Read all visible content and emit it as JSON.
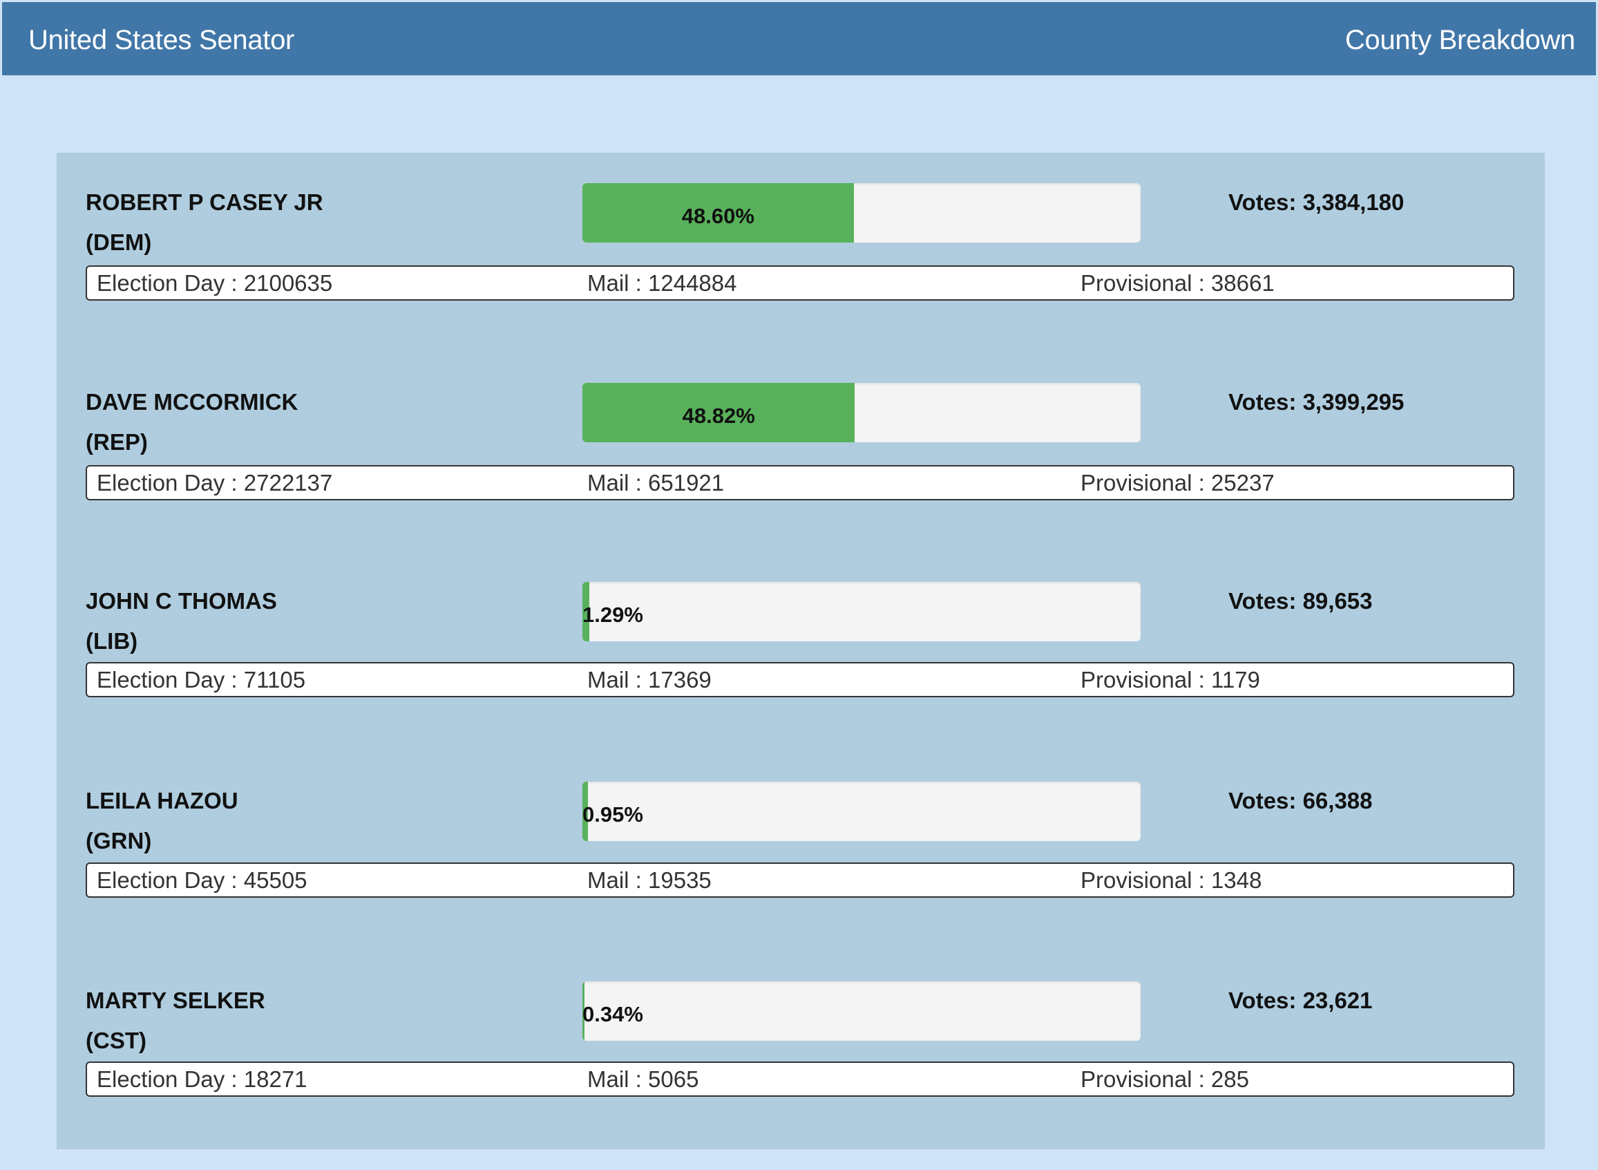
{
  "header": {
    "title": "United States Senator",
    "county_link": "County Breakdown"
  },
  "candidates": [
    {
      "name": "ROBERT P CASEY JR",
      "party": "(DEM)",
      "percent_label": "48.60%",
      "percent": 48.6,
      "votes_label": "Votes: 3,384,180",
      "election_day": "Election Day : 2100635",
      "mail": "Mail : 1244884",
      "provisional": "Provisional : 38661",
      "bar_color": "#59b25b"
    },
    {
      "name": "DAVE MCCORMICK",
      "party": "(REP)",
      "percent_label": "48.82%",
      "percent": 48.82,
      "votes_label": "Votes: 3,399,295",
      "election_day": "Election Day : 2722137",
      "mail": "Mail : 651921",
      "provisional": "Provisional : 25237",
      "bar_color": "#59b25b"
    },
    {
      "name": "JOHN C THOMAS",
      "party": "(LIB)",
      "percent_label": "1.29%",
      "percent": 1.29,
      "votes_label": "Votes: 89,653",
      "election_day": "Election Day : 71105",
      "mail": "Mail : 17369",
      "provisional": "Provisional : 1179",
      "bar_color": "#59b25b"
    },
    {
      "name": "LEILA HAZOU",
      "party": "(GRN)",
      "percent_label": "0.95%",
      "percent": 0.95,
      "votes_label": "Votes: 66,388",
      "election_day": "Election Day : 45505",
      "mail": "Mail : 19535",
      "provisional": "Provisional : 1348",
      "bar_color": "#59b25b"
    },
    {
      "name": "MARTY SELKER",
      "party": "(CST)",
      "percent_label": "0.34%",
      "percent": 0.34,
      "votes_label": "Votes: 23,621",
      "election_day": "Election Day : 18271",
      "mail": "Mail : 5065",
      "provisional": "Provisional : 285",
      "bar_color": "#59b25b"
    }
  ]
}
